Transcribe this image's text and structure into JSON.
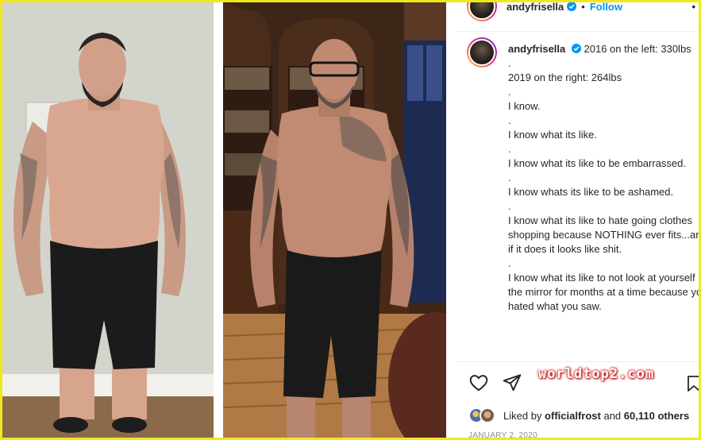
{
  "post": {
    "header": {
      "username": "andyfrisella",
      "separator": "•",
      "follow_label": "Follow",
      "more_label": "•"
    },
    "caption": {
      "username": "andyfrisella",
      "lines": [
        "2016 on the left: 330lbs",
        ".",
        "2019 on the right: 264lbs",
        ".",
        "I know.",
        ".",
        "I know what its like.",
        ".",
        "I know what its like to be embarrassed.",
        ".",
        "I know whats its like to be ashamed.",
        ".",
        "I know what its like to hate going clothes shopping because NOTHING ever fits...and if it does it looks like shit.",
        ".",
        "I know what its like to not look at yourself in the mirror for months at a time because you hated what you saw."
      ]
    },
    "actions": {
      "like_icon": "heart-icon",
      "share_icon": "send-icon",
      "save_icon": "bookmark-icon"
    },
    "likes": {
      "prefix": "Liked by",
      "user": "officialfrost",
      "middle": "and",
      "count": "60,110 others"
    },
    "date": "JANUARY 2, 2020"
  },
  "watermark": "worldtop2.com",
  "colors": {
    "frame": "#f0e81e",
    "follow": "#0095f6",
    "verified": "#0095f6",
    "watermark_glow": "#d01a1a"
  }
}
